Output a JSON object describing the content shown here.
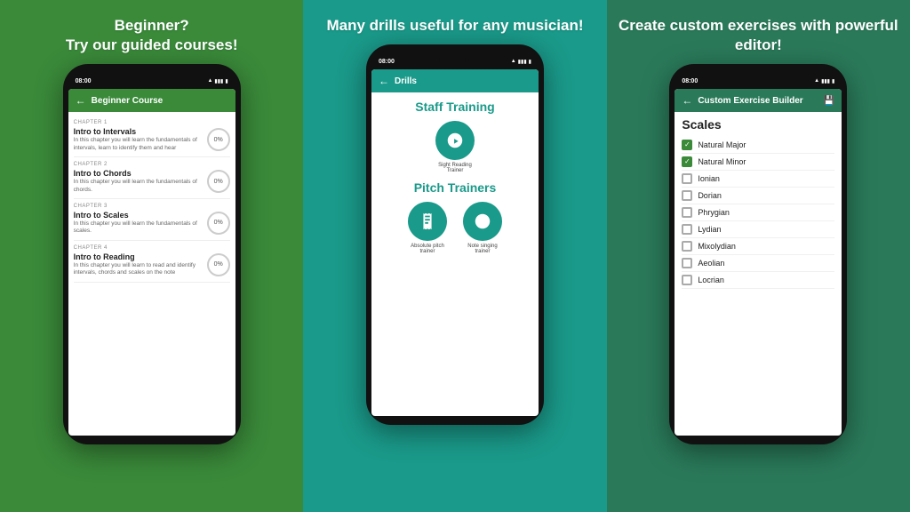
{
  "panels": {
    "left": {
      "headline": "Beginner?\nTry our guided courses!",
      "phone": {
        "time": "08:00",
        "header": {
          "title": "Beginner Course"
        },
        "chapters": [
          {
            "label": "CHAPTER 1",
            "name": "Intro to Intervals",
            "desc": "In this chapter you will learn the fundamentals of intervals, learn to identify them and hear",
            "progress": "0%"
          },
          {
            "label": "CHAPTER 2",
            "name": "Intro to Chords",
            "desc": "In this chapter you will learn the fundamentals of chords.",
            "progress": "0%"
          },
          {
            "label": "CHAPTER 3",
            "name": "Intro to Scales",
            "desc": "In this chapter you will learn the fundamentals of scales.",
            "progress": "0%"
          },
          {
            "label": "CHAPTER 4",
            "name": "Intro to Reading",
            "desc": "In this chapter you will learn to read and identify intervals, chords and scales on the note",
            "progress": "0%"
          }
        ]
      }
    },
    "center": {
      "headline": "Many drills useful for any musician!",
      "phone": {
        "time": "08:00",
        "header": {
          "title": "Drills"
        },
        "staff_training": {
          "section_title": "Staff Training",
          "items": [
            {
              "label": "Sight Reading Trainer",
              "icon": "♪"
            }
          ]
        },
        "pitch_trainers": {
          "section_title": "Pitch Trainers",
          "items": [
            {
              "label": "Absolute pitch trainer",
              "icon": "𝄐"
            },
            {
              "label": "Note singing trainer",
              "icon": "🎵"
            }
          ]
        }
      }
    },
    "right": {
      "headline": "Create custom exercises with powerful editor!",
      "phone": {
        "time": "08:00",
        "header": {
          "title": "Custom Exercise Builder"
        },
        "scales": {
          "title": "Scales",
          "items": [
            {
              "name": "Natural Major",
              "checked": true
            },
            {
              "name": "Natural Minor",
              "checked": true
            },
            {
              "name": "Ionian",
              "checked": false
            },
            {
              "name": "Dorian",
              "checked": false
            },
            {
              "name": "Phrygian",
              "checked": false
            },
            {
              "name": "Lydian",
              "checked": false
            },
            {
              "name": "Mixolydian",
              "checked": false
            },
            {
              "name": "Aeolian",
              "checked": false
            },
            {
              "name": "Locrian",
              "checked": false
            }
          ]
        }
      }
    }
  }
}
